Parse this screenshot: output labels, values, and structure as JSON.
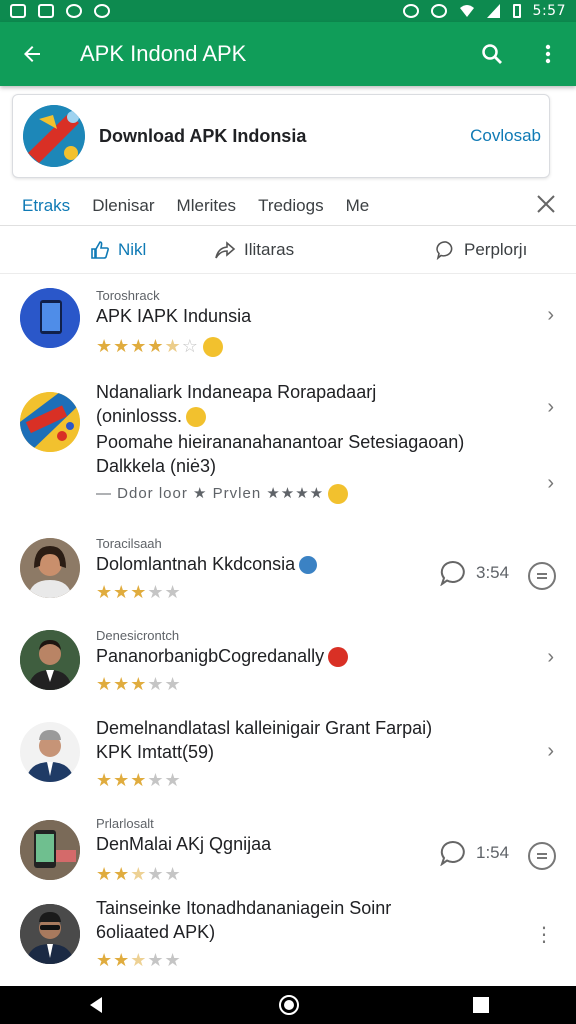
{
  "status": {
    "time": "5:57"
  },
  "appbar": {
    "title": "APK Indond APK"
  },
  "card": {
    "title": "Download APK Indonsia",
    "button": "Covlosab"
  },
  "tabs": [
    "Etraks",
    "Dlenisar",
    "Mlerites",
    "Trediogs",
    "Me"
  ],
  "filters": {
    "f1": "Nikl",
    "f2": "Ilitaras",
    "f3": "Perplorjı"
  },
  "items": [
    {
      "category": "Toroshrack",
      "name": "APK IAPK Indunsia",
      "rating": 4.5
    },
    {
      "name": "Ndanaliark Indaneapa Rorapadaarj",
      "line2": "(oninlosss.",
      "line3": "Poomahe hieirananahanantoar Setesiagaoan)",
      "line4": "Dalkkela (niė3)",
      "meta": "— Ddor loor ★ Prvlen ★★★★"
    },
    {
      "category": "Toracilsaah",
      "name": "Dolomlantnah Kkdconsia",
      "rating": 3,
      "comments": "3:54"
    },
    {
      "category": "Denesicrontch",
      "name": "PananorbanigbCogredanally",
      "rating": 3
    },
    {
      "name": "Demelnandlatasl kalleinigair Grant Farpai)",
      "line2": "KPK Imtatt(59)",
      "rating": 3
    },
    {
      "category": "Prlarlosalt",
      "name": "DenMalai AKj Qgnijaa",
      "rating": 2.5,
      "comments": "1:54"
    },
    {
      "name": "Tainseinke Itonadhdananiagein Soinr",
      "line2": "6oliaated APK)",
      "rating": 2.5
    }
  ]
}
